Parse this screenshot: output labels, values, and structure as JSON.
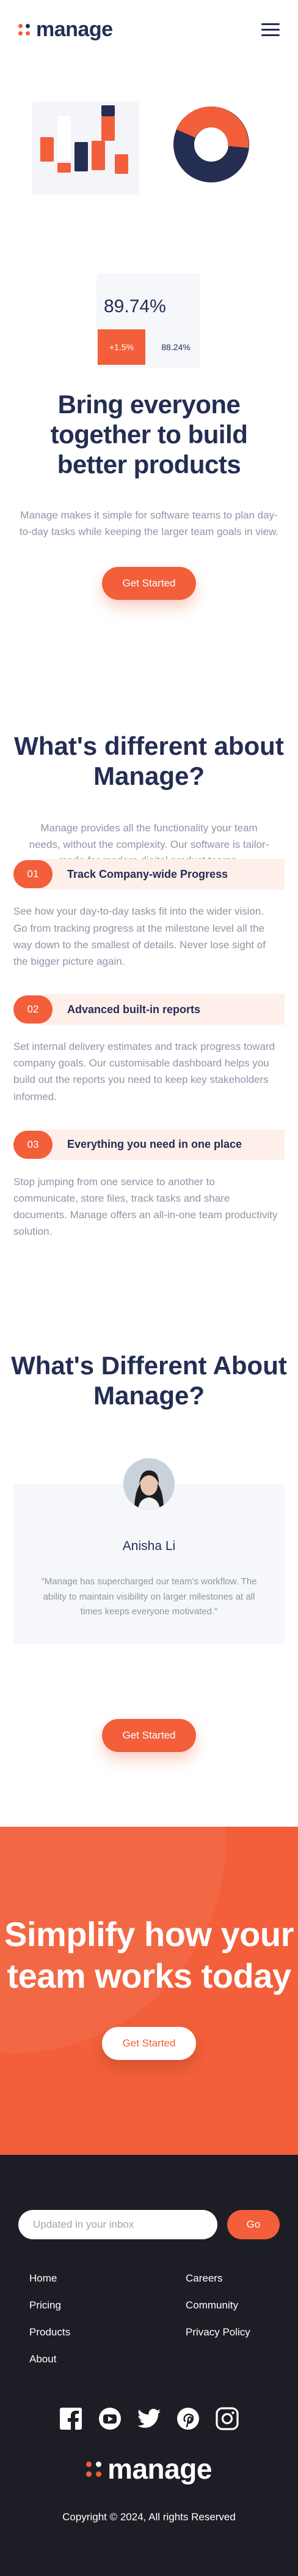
{
  "header": {
    "logo_text": "manage",
    "menu_icon": "hamburger-menu-icon"
  },
  "hero": {
    "stat_value": "89.74%",
    "stat_change": "+1.5%",
    "stat_compare": "88.24%",
    "title": "Bring everyone together to build better products",
    "description": "Manage makes it simple for software teams to plan day-to-day tasks while keeping the larger team goals in view.",
    "cta_label": "Get Started"
  },
  "different": {
    "title": "What's different about Manage?",
    "description": "Manage provides all the functionality your team needs, without the complexity. Our software is tailor-made for modern digital product teams.",
    "features": [
      {
        "number": "01",
        "title": "Track Company-wide Progress",
        "text": "See how your day-to-day tasks fit into the wider vision. Go from tracking progress at the milestone level all the way down to the smallest of details. Never lose sight of the bigger picture again."
      },
      {
        "number": "02",
        "title": "Advanced built-in reports",
        "text": "Set internal delivery estimates and track progress toward company goals. Our customisable dashboard helps you build out the reports you need to keep key stakeholders informed."
      },
      {
        "number": "03",
        "title": "Everything you need in one place",
        "text": "Stop jumping from one service to another to communicate, store files, track tasks and share documents. Manage offers an all-in-one team productivity solution."
      }
    ]
  },
  "testimonial": {
    "title": "What's Different About Manage?",
    "name": "Anisha Li",
    "quote": "\"Manage has supercharged our team's workflow. The ability to maintain visibility on larger milestones at all times keeps everyone motivated.\"",
    "cta_label": "Get Started"
  },
  "cta": {
    "title": "Simplify how your team works today",
    "button_label": "Get Started"
  },
  "footer": {
    "newsletter_placeholder": "Updated in your inbox",
    "newsletter_button": "Go",
    "links_left": [
      "Home",
      "Pricing",
      "Products",
      "About"
    ],
    "links_right": [
      "Careers",
      "Community",
      "Privacy Policy"
    ],
    "social_icons": [
      "facebook-icon",
      "youtube-icon",
      "twitter-icon",
      "pinterest-icon",
      "instagram-icon"
    ],
    "logo_text": "manage",
    "copyright": "Copyright © 2024, All rights Reserved"
  },
  "colors": {
    "accent": "#f25f3a",
    "navy": "#242d52",
    "muted": "#9095a7",
    "tint": "#ffefeb",
    "footer_bg": "#1d1e25"
  }
}
